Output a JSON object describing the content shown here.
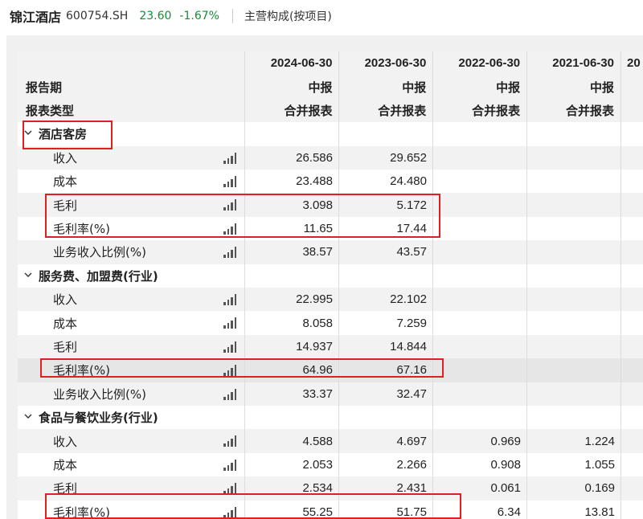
{
  "header": {
    "stock_name": "锦江酒店",
    "stock_code": "600754.SH",
    "price": "23.60",
    "change": "-1.67%",
    "tab": "主营构成(按项目)"
  },
  "table": {
    "col_dates": [
      "2024-06-30",
      "2023-06-30",
      "2022-06-30",
      "2021-06-30",
      "20"
    ],
    "period_label": "报告期",
    "period_values": [
      "中报",
      "中报",
      "中报",
      "中报",
      ""
    ],
    "type_label": "报表类型",
    "type_values": [
      "合并报表",
      "合并报表",
      "合并报表",
      "合并报表",
      ""
    ],
    "sections": [
      {
        "name": "酒店客房",
        "rows": [
          {
            "label": "收入",
            "values": [
              "26.586",
              "29.652",
              "",
              ""
            ]
          },
          {
            "label": "成本",
            "values": [
              "23.488",
              "24.480",
              "",
              ""
            ]
          },
          {
            "label": "毛利",
            "values": [
              "3.098",
              "5.172",
              "",
              ""
            ]
          },
          {
            "label": "毛利率(%)",
            "values": [
              "11.65",
              "17.44",
              "",
              ""
            ]
          },
          {
            "label": "业务收入比例(%)",
            "values": [
              "38.57",
              "43.57",
              "",
              ""
            ]
          }
        ]
      },
      {
        "name": "服务费、加盟费(行业)",
        "rows": [
          {
            "label": "收入",
            "values": [
              "22.995",
              "22.102",
              "",
              ""
            ]
          },
          {
            "label": "成本",
            "values": [
              "8.058",
              "7.259",
              "",
              ""
            ]
          },
          {
            "label": "毛利",
            "values": [
              "14.937",
              "14.844",
              "",
              ""
            ]
          },
          {
            "label": "毛利率(%)",
            "values": [
              "64.96",
              "67.16",
              "",
              ""
            ]
          },
          {
            "label": "业务收入比例(%)",
            "values": [
              "33.37",
              "32.47",
              "",
              ""
            ]
          }
        ]
      },
      {
        "name": "食品与餐饮业务(行业)",
        "rows": [
          {
            "label": "收入",
            "values": [
              "4.588",
              "4.697",
              "0.969",
              "1.224"
            ]
          },
          {
            "label": "成本",
            "values": [
              "2.053",
              "2.266",
              "0.908",
              "1.055"
            ]
          },
          {
            "label": "毛利",
            "values": [
              "2.534",
              "2.431",
              "0.061",
              "0.169"
            ]
          },
          {
            "label": "毛利率(%)",
            "values": [
              "55.25",
              "51.75",
              "6.34",
              "13.81"
            ]
          }
        ]
      }
    ]
  },
  "colors": {
    "positive_green": "#1a8a3a",
    "highlight_red": "#e02020"
  },
  "icons": {
    "section_toggle": "chevron-down-icon",
    "row_chart": "bar-chart-icon"
  }
}
